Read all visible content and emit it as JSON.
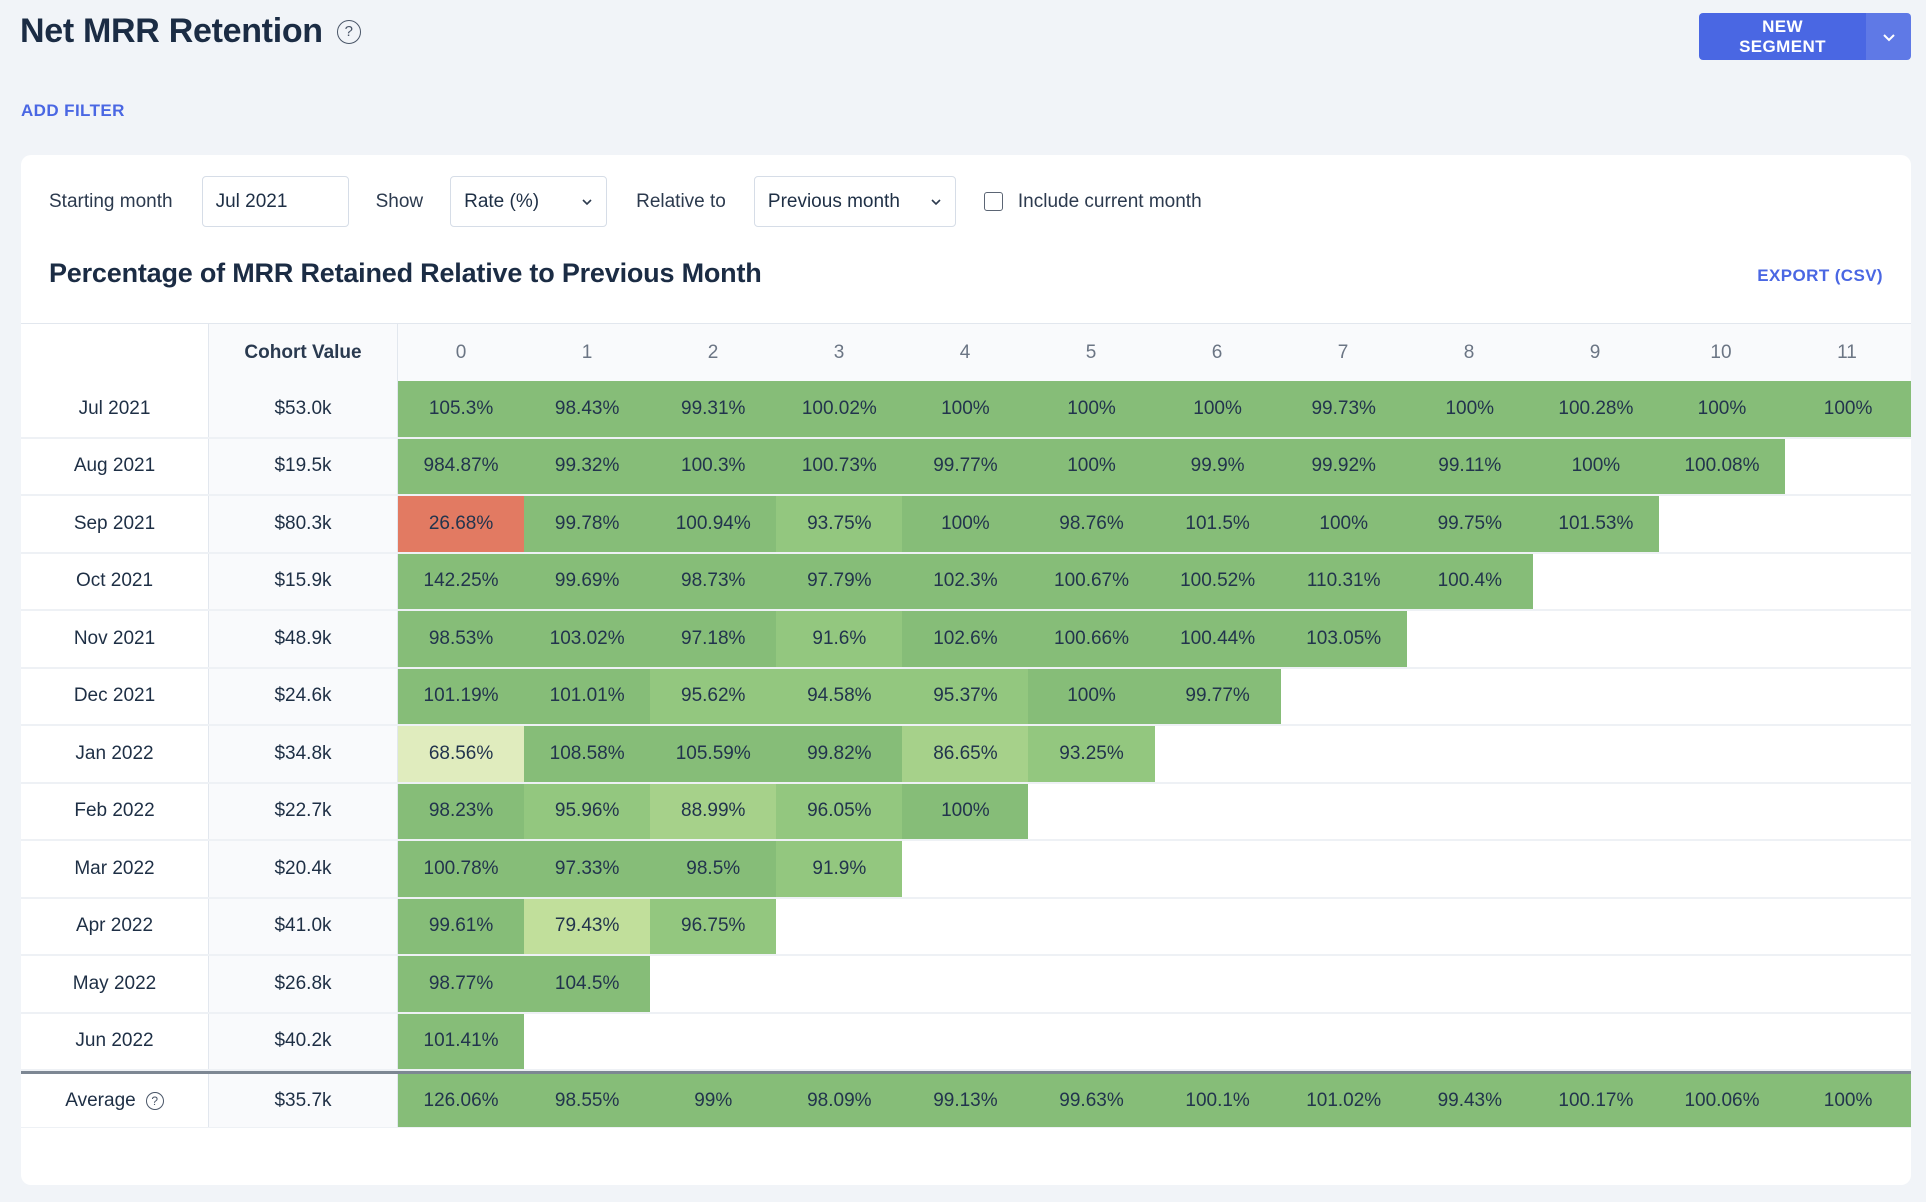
{
  "header": {
    "title": "Net MRR Retention",
    "help_icon": "question-circle-icon",
    "new_segment_label": "NEW SEGMENT",
    "dropdown_icon": "chevron-down-icon",
    "add_filter_label": "ADD FILTER"
  },
  "controls": {
    "starting_month_label": "Starting month",
    "starting_month_value": "Jul 2021",
    "show_label": "Show",
    "show_value": "Rate (%)",
    "relative_label": "Relative to",
    "relative_value": "Previous month",
    "include_current_label": "Include current month",
    "include_current_checked": false
  },
  "section": {
    "title": "Percentage of MRR Retained Relative to Previous Month",
    "export_label": "EXPORT (CSV)"
  },
  "colors": {
    "accent": "#4a67e3",
    "cell_high": "#86bd78",
    "cell_mid": "#93c77f",
    "cell_light": "#a6d18a",
    "cell_lighter": "#c1df9b",
    "cell_pale": "#e0ecbe",
    "cell_bad": "#e27a62"
  },
  "chart_data": {
    "type": "heatmap",
    "title": "Percentage of MRR Retained Relative to Previous Month",
    "row_header": "",
    "cohort_header": "Cohort Value",
    "columns": [
      "0",
      "1",
      "2",
      "3",
      "4",
      "5",
      "6",
      "7",
      "8",
      "9",
      "10",
      "11"
    ],
    "rows": [
      {
        "month": "Jul 2021",
        "cohort_value": "$53.0k",
        "values": [
          "105.3%",
          "98.43%",
          "99.31%",
          "100.02%",
          "100%",
          "100%",
          "100%",
          "99.73%",
          "100%",
          "100.28%",
          "100%",
          "100%"
        ]
      },
      {
        "month": "Aug 2021",
        "cohort_value": "$19.5k",
        "values": [
          "984.87%",
          "99.32%",
          "100.3%",
          "100.73%",
          "99.77%",
          "100%",
          "99.9%",
          "99.92%",
          "99.11%",
          "100%",
          "100.08%"
        ]
      },
      {
        "month": "Sep 2021",
        "cohort_value": "$80.3k",
        "values": [
          "26.68%",
          "99.78%",
          "100.94%",
          "93.75%",
          "100%",
          "98.76%",
          "101.5%",
          "100%",
          "99.75%",
          "101.53%"
        ]
      },
      {
        "month": "Oct 2021",
        "cohort_value": "$15.9k",
        "values": [
          "142.25%",
          "99.69%",
          "98.73%",
          "97.79%",
          "102.3%",
          "100.67%",
          "100.52%",
          "110.31%",
          "100.4%"
        ]
      },
      {
        "month": "Nov 2021",
        "cohort_value": "$48.9k",
        "values": [
          "98.53%",
          "103.02%",
          "97.18%",
          "91.6%",
          "102.6%",
          "100.66%",
          "100.44%",
          "103.05%"
        ]
      },
      {
        "month": "Dec 2021",
        "cohort_value": "$24.6k",
        "values": [
          "101.19%",
          "101.01%",
          "95.62%",
          "94.58%",
          "95.37%",
          "100%",
          "99.77%"
        ]
      },
      {
        "month": "Jan 2022",
        "cohort_value": "$34.8k",
        "values": [
          "68.56%",
          "108.58%",
          "105.59%",
          "99.82%",
          "86.65%",
          "93.25%"
        ]
      },
      {
        "month": "Feb 2022",
        "cohort_value": "$22.7k",
        "values": [
          "98.23%",
          "95.96%",
          "88.99%",
          "96.05%",
          "100%"
        ]
      },
      {
        "month": "Mar 2022",
        "cohort_value": "$20.4k",
        "values": [
          "100.78%",
          "97.33%",
          "98.5%",
          "91.9%"
        ]
      },
      {
        "month": "Apr 2022",
        "cohort_value": "$41.0k",
        "values": [
          "99.61%",
          "79.43%",
          "96.75%"
        ]
      },
      {
        "month": "May 2022",
        "cohort_value": "$26.8k",
        "values": [
          "98.77%",
          "104.5%"
        ]
      },
      {
        "month": "Jun 2022",
        "cohort_value": "$40.2k",
        "values": [
          "101.41%"
        ]
      }
    ],
    "average": {
      "label": "Average",
      "cohort_value": "$35.7k",
      "values": [
        "126.06%",
        "98.55%",
        "99%",
        "98.09%",
        "99.13%",
        "99.63%",
        "100.1%",
        "101.02%",
        "99.43%",
        "100.17%",
        "100.06%",
        "100%"
      ]
    }
  }
}
